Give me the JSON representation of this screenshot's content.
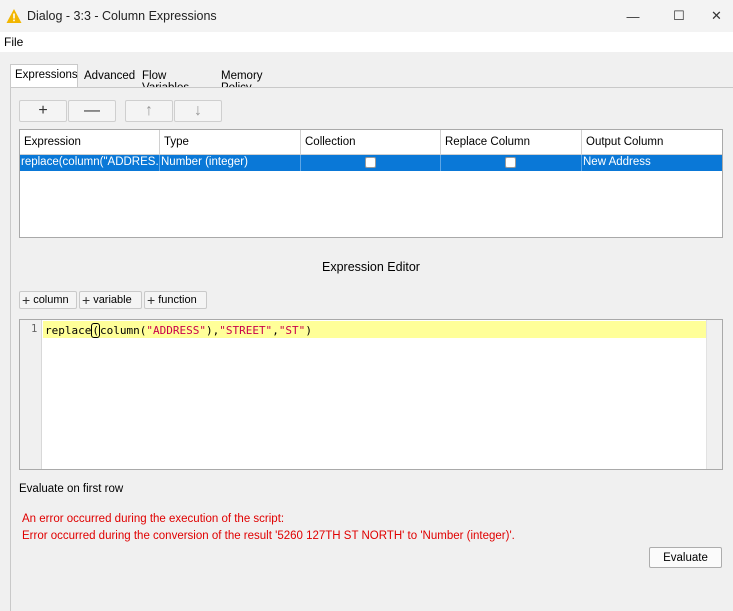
{
  "window": {
    "title": "Dialog - 3:3 - Column Expressions",
    "minimize_glyph": "—",
    "maximize_glyph": "☐",
    "close_glyph": "✕",
    "warning_color": "#f2b600"
  },
  "menu": {
    "file": "File"
  },
  "tabs": [
    {
      "label": "Expressions",
      "active": true
    },
    {
      "label": "Advanced"
    },
    {
      "label": "Flow Variables"
    },
    {
      "label": "Memory Policy"
    }
  ],
  "toolbar": {
    "add": "+",
    "remove": "—",
    "up": "↑",
    "down": "↓"
  },
  "table": {
    "columns": [
      "Expression",
      "Type",
      "Collection",
      "Replace Column",
      "Output Column"
    ],
    "rows": [
      {
        "expression": "replace(column(\"ADDRES...",
        "type": "Number (integer)",
        "collection": false,
        "replace_column": false,
        "output_column": "New Address",
        "selected": true
      }
    ]
  },
  "editor": {
    "title": "Expression Editor",
    "insert_buttons": [
      "column",
      "variable",
      "function"
    ],
    "line_number": "1",
    "code_parts": {
      "fn1": "replace",
      "paren_open": "(",
      "fn2": "column(",
      "str1": "\"ADDRESS\"",
      "mid1": "),",
      "str2": "\"STREET\"",
      "comma": ",",
      "str3": "\"ST\"",
      "close": ")"
    }
  },
  "evaluation": {
    "label": "Evaluate on first row",
    "error_line1": "An error occurred during the execution of the script:",
    "error_line2": "Error occurred during the conversion of the result '5260 127TH ST NORTH' to 'Number (integer)'.",
    "button": "Evaluate",
    "error_color": "#e00000"
  }
}
